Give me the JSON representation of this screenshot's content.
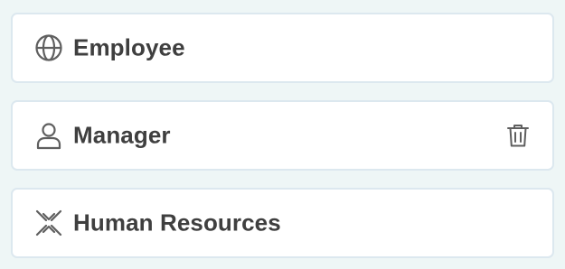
{
  "items": [
    {
      "label": "Employee",
      "icon": "globe-icon"
    },
    {
      "label": "Manager",
      "icon": "user-icon",
      "action_icon": "trash-icon"
    },
    {
      "label": "Human Resources",
      "icon": "arrows-cross-icon"
    }
  ],
  "colors": {
    "background": "#eef6f6",
    "card": "#ffffff",
    "card_border": "#dce8ef",
    "text": "#3f3f3f",
    "icon": "#5f5f5f"
  }
}
